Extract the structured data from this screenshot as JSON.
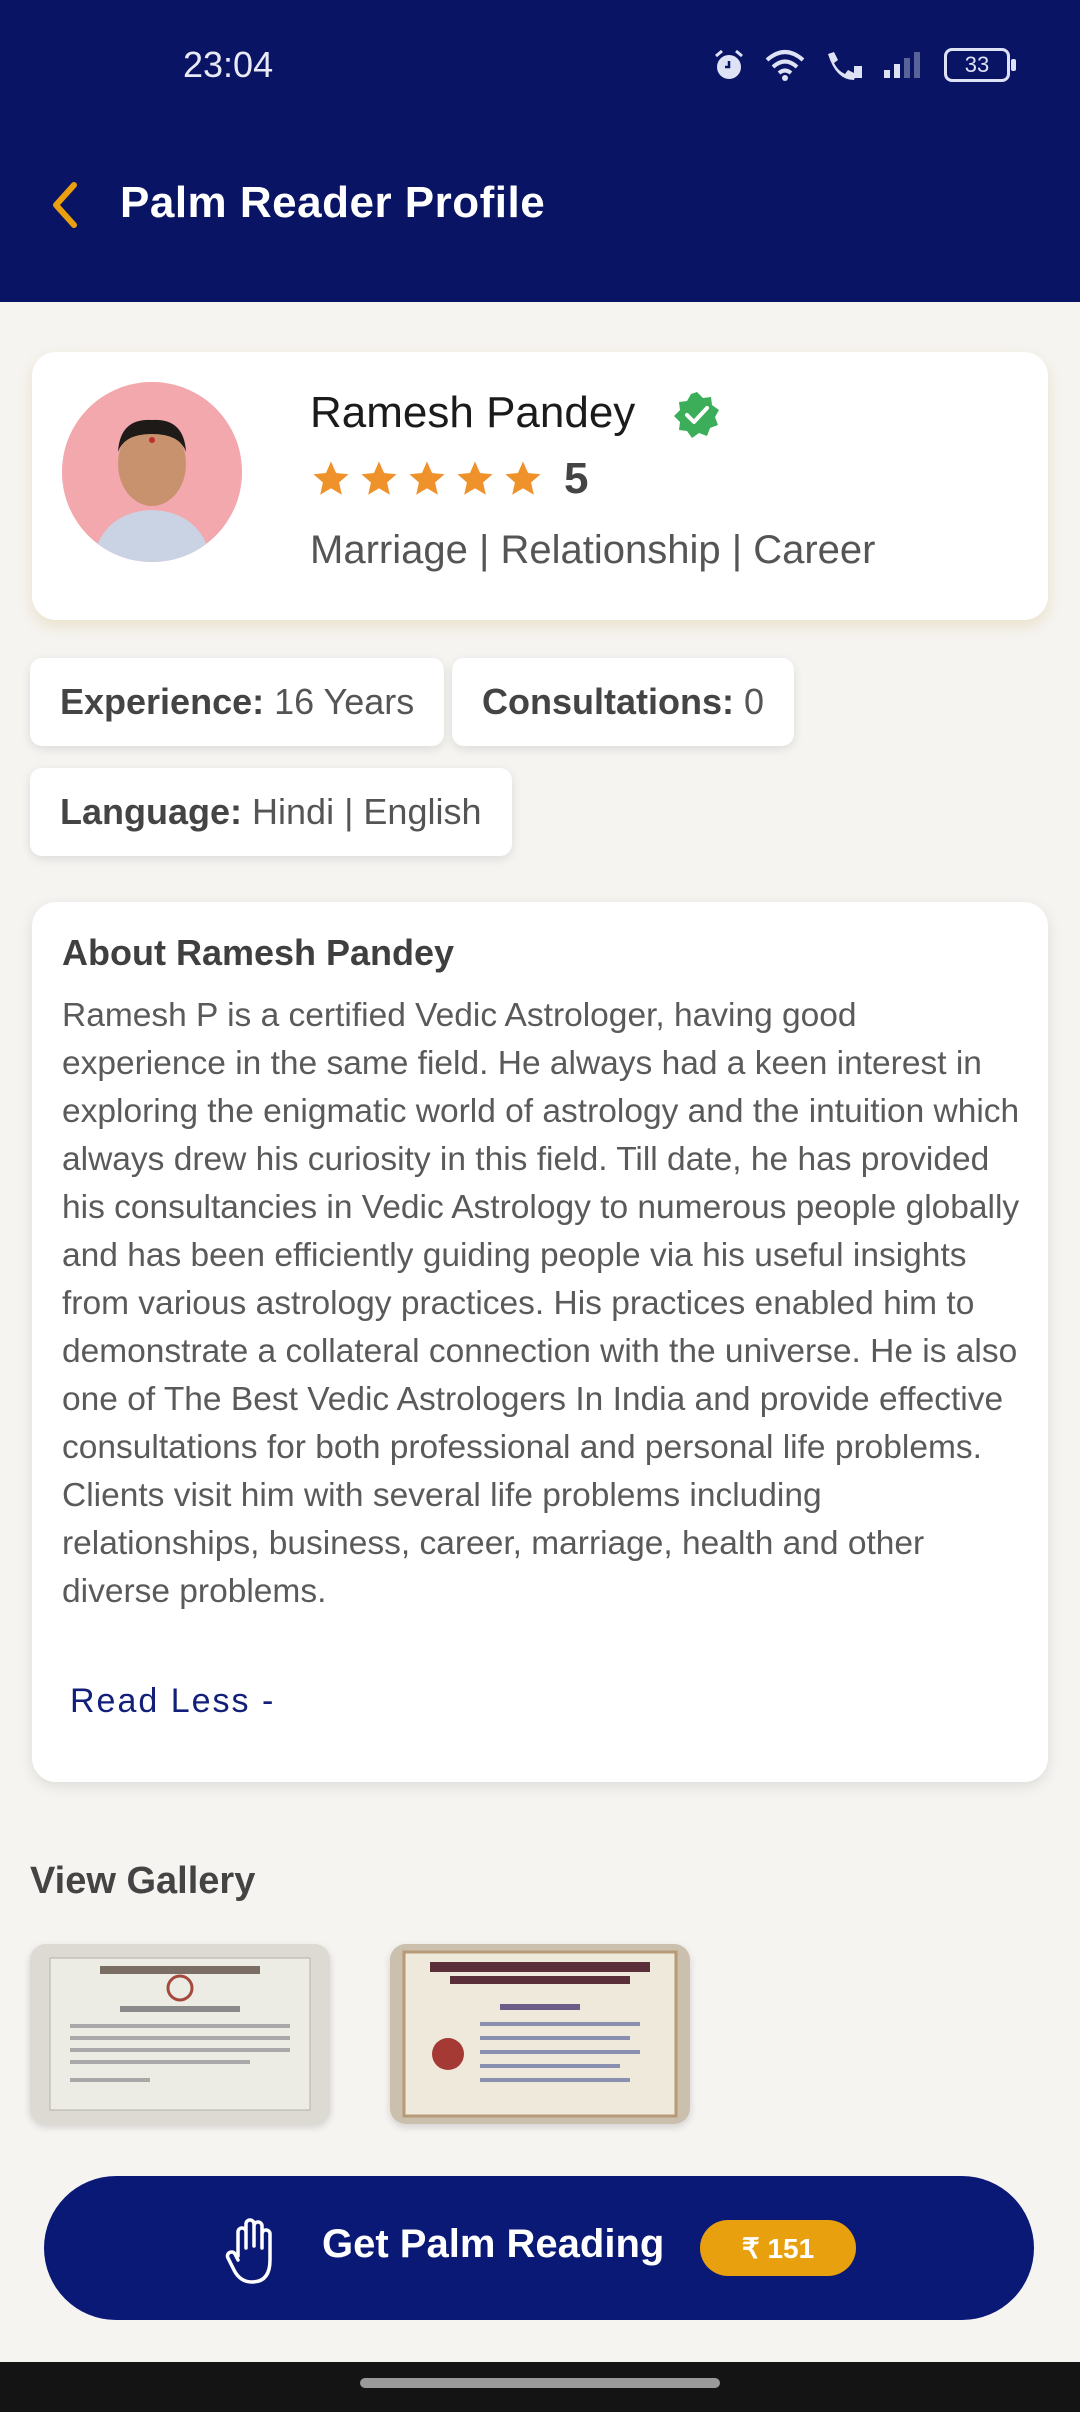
{
  "status_bar": {
    "time": "23:04",
    "battery": "33"
  },
  "header": {
    "title": "Palm Reader Profile"
  },
  "profile": {
    "name": "Ramesh Pandey",
    "rating": "5",
    "rating_stars": 5,
    "specialties": "Marriage | Relationship | Career"
  },
  "info": {
    "experience_label": "Experience:",
    "experience_value": "16 Years",
    "consultations_label": "Consultations:",
    "consultations_value": "0",
    "language_label": "Language:",
    "language_value": "Hindi | English"
  },
  "about": {
    "title": "About Ramesh Pandey",
    "text": "Ramesh P is a certified Vedic Astrologer, having good experience in the same field. He always had a keen interest in exploring the enigmatic world of astrology and the intuition which always drew his curiosity in this field. Till date, he has provided his consultancies in Vedic Astrology to numerous people globally and has been efficiently guiding people via his useful insights from various astrology practices. His practices enabled him to demonstrate a collateral connection with the universe. He is also one of The Best Vedic Astrologers In India and provide effective consultations for both professional and personal life problems. Clients visit him with several life problems including relationships, business, career, marriage, health and other diverse problems.",
    "read_less": "Read Less -"
  },
  "gallery": {
    "title": "View Gallery"
  },
  "cta": {
    "label": "Get Palm Reading",
    "price": "₹ 151"
  },
  "colors": {
    "header_bg": "#0a1464",
    "accent_orange": "#e8a00e",
    "star": "#f0922b",
    "verified": "#3cae5a"
  }
}
